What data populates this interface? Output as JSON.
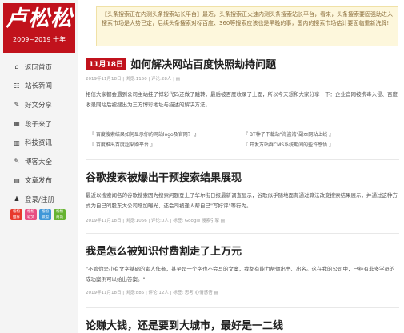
{
  "logo": {
    "name": "卢松松",
    "tagline": "2009~2019 十年"
  },
  "nav": [
    {
      "icon": "home-icon",
      "glyph": "⌂",
      "label": "返回首页"
    },
    {
      "icon": "news-icon",
      "glyph": "☷",
      "label": "站长新闻"
    },
    {
      "icon": "pen-icon",
      "glyph": "✎",
      "label": "好文分享"
    },
    {
      "icon": "grid-icon",
      "glyph": "▦",
      "label": "段子来了"
    },
    {
      "icon": "book-icon",
      "glyph": "▥",
      "label": "科技资讯"
    },
    {
      "icon": "blog-icon",
      "glyph": "✎",
      "label": "博客大全"
    },
    {
      "icon": "publish-icon",
      "glyph": "▤",
      "label": "文章发布"
    },
    {
      "icon": "user-icon",
      "glyph": "♟",
      "label": "登录/注册"
    }
  ],
  "tiles": [
    {
      "color": "red",
      "label": "松松\n推荐"
    },
    {
      "color": "pink",
      "label": "松松\n软文"
    },
    {
      "color": "blue",
      "label": "松松\n联盟"
    },
    {
      "color": "green",
      "label": "松松\n商城"
    }
  ],
  "notice": "【头条搜索正在内测头条搜索站长平台】最近，头条搜索正火速内测头条搜索站长平台，看来，头条搜索要固强助进入搜索市场是大势已定，后续头条搜索对标百度、360等搜索应该也是早晚的事，国内的搜索市场估计要面临重新洗牌!",
  "articles": [
    {
      "date": "11月18日",
      "title": "如何解决网站百度快照劫持问题",
      "meta": "2019年11月18日 | 浏览:1150 | 评论:28人 | ▤",
      "excerpt": "相信大家都会遇到公司主站挂了博彩代码还做了跳转，最后被百度收录了上面，所以今天想和大家分享一下：企业官网被携毒入侵、百度收录网站后被搜出为三方博彩地址与描述的解决方法。"
    },
    {
      "date": "",
      "title": "谷歌搜索被爆出干预搜索结果展现",
      "meta": "2019年11月18日 | 浏览:1056 | 评论:0人 | 标签: Google 搜索引擎 ▤",
      "excerpt": "最近以搜索闻名的谷歌搜索因为搜索问题登上了华尔街日报最新调查显示，谷歌似乎随地面有通过算法改变搜索结果展示，并通过这种方式为自己的股东大公司增加曝光，还会司被逢人帮自己\"写好评\"等行为。"
    },
    {
      "date": "",
      "title": "我是怎么被知识付费割走了上万元",
      "meta": "2019年11月18日 | 浏览:885 | 评论:12人 | 标签: 思考 心情感悟 ▤",
      "excerpt": "\"不管你是小有文字基础的素人作者，甚至是一个字也不会写的文案，我都有能力帮你出书、出名。这在我的公司中，已经有非多学员的成功案例可以给出答案。\""
    },
    {
      "date": "",
      "title": "论赚大钱，还是要到大城市，最好是一二线"
    }
  ],
  "links": [
    "『 百度搜索结果如何显示你的网站logo及官网？ 』",
    "『 百度推出百度超采购平台 』",
    "『 BT种子下载站\"海盗湾\"副本网站上线 』",
    "『 开发万站群CMS系统期间的些许感悟 』"
  ]
}
